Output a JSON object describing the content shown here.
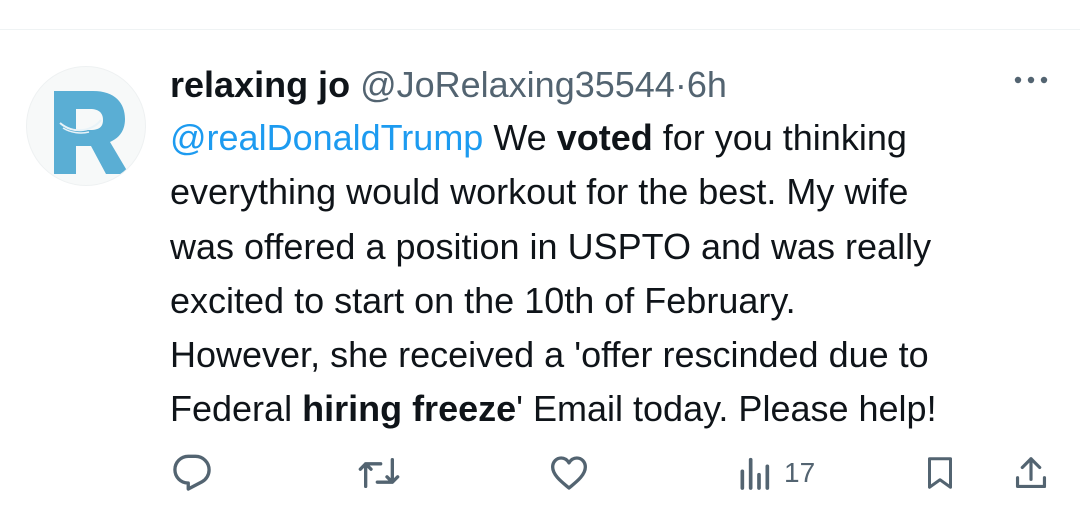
{
  "tweet": {
    "author_name": "relaxing jo",
    "author_handle": "@JoRelaxing35544",
    "separator": "·",
    "time": "6h",
    "mention": "@realDonaldTrump",
    "text": {
      "l1_a": " We ",
      "l1_bold": "voted",
      "l1_b": " for you thinking",
      "l2": "everything would workout for the best. My wife",
      "l3": "was offered a position in USPTO and was really",
      "l4": "excited to start on the 10th of February.",
      "l5": "However, she received a 'offer rescinded due to",
      "l6_a": "Federal ",
      "l6_bold": "hiring freeze",
      "l6_b": "' Email today. Please help!"
    }
  },
  "actions": {
    "views_count": "17"
  },
  "icons": {
    "avatar": "letter-r-logo-icon",
    "more": "more-dots-icon",
    "reply": "reply-icon",
    "retweet": "retweet-icon",
    "like": "heart-icon",
    "views": "views-bar-chart-icon",
    "bookmark": "bookmark-icon",
    "share": "share-icon"
  },
  "colors": {
    "text": "#0f1419",
    "secondary": "#536471",
    "link": "#1d9bf0",
    "avatar_logo": "#5aaed4"
  }
}
